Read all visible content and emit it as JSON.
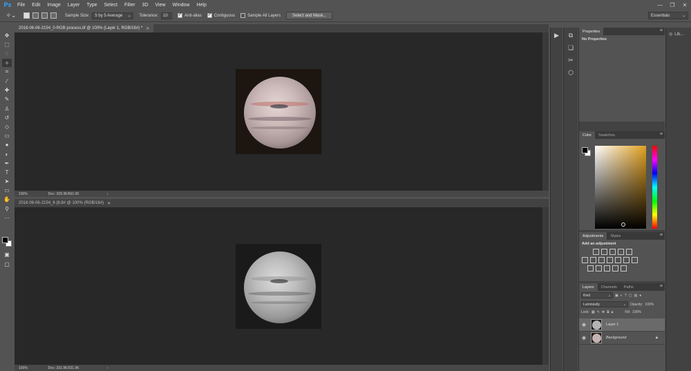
{
  "app": {
    "logo": "Ps"
  },
  "menu": [
    "File",
    "Edit",
    "Image",
    "Layer",
    "Type",
    "Select",
    "Filter",
    "3D",
    "View",
    "Window",
    "Help"
  ],
  "window_controls": {
    "minimize": "—",
    "maximize": "❐",
    "close": "✕"
  },
  "options": {
    "tool_icon": "magic-wand-icon",
    "sample_size_label": "Sample Size:",
    "sample_size_value": "5 by 5 Average",
    "tolerance_label": "Tolerance:",
    "tolerance_value": "10",
    "anti_alias_label": "Anti-alias",
    "contiguous_label": "Contiguous",
    "sample_all_layers_label": "Sample All Layers",
    "select_mask_label": "Select and Mask..."
  },
  "workspace": "Essentials",
  "documents": [
    {
      "tab_title": "2018-06-06-2154_0-RGB process.tif @ 100% (Layer 1, RGB/16#) *",
      "zoom": "100%",
      "doc_size": "Doc: 329.3K/661.0K",
      "planet_color": "#c4b2b2",
      "frame_color": "#1c1510"
    },
    {
      "tab_title": "2018-06-06-2154_6 (8,8# @ 100% (RGB/16#)",
      "zoom": "100%",
      "doc_size": "Doc: 331.9K/331.9K",
      "planet_color": "#b4b4b4",
      "frame_color": "#1a1a1a"
    }
  ],
  "panels": {
    "properties": {
      "tab": "Properties",
      "title": "No Properties"
    },
    "color": {
      "tabs": [
        "Color",
        "Swatches"
      ]
    },
    "adjustments": {
      "tabs": [
        "Adjustments",
        "Styles"
      ],
      "label": "Add an adjustment"
    },
    "layers": {
      "tabs": [
        "Layers",
        "Channels",
        "Paths"
      ],
      "filter_kind": "Kind",
      "blend_mode": "Luminosity",
      "opacity_label": "Opacity:",
      "opacity_value": "100%",
      "lock_label": "Lock:",
      "fill_label": "Fill:",
      "fill_value": "100%",
      "items": [
        {
          "name": "Layer 1",
          "selected": true
        },
        {
          "name": "Background",
          "selected": false,
          "locked": true
        }
      ]
    }
  },
  "libraries": {
    "label": "Lib..."
  }
}
